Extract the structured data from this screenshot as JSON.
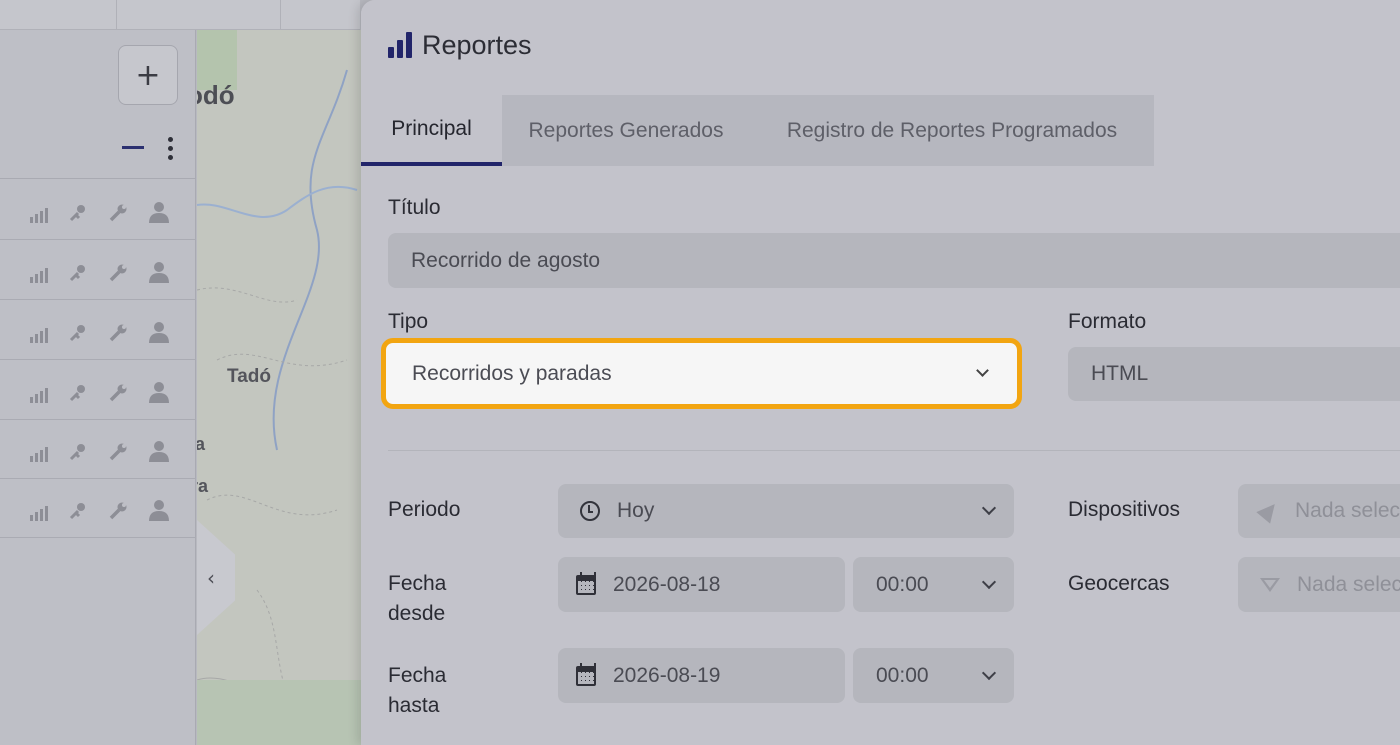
{
  "map": {
    "labels": [
      "odó",
      "Tadó",
      "a",
      "ra"
    ]
  },
  "modal": {
    "title": "Reportes",
    "tabs": [
      {
        "label": "Principal",
        "active": true
      },
      {
        "label": "Reportes Generados",
        "active": false
      },
      {
        "label": "Registro de Reportes Programados",
        "active": false
      }
    ]
  },
  "form": {
    "title_label": "Título",
    "title_value": "Recorrido de agosto",
    "type_label": "Tipo",
    "type_value": "Recorridos y paradas",
    "format_label": "Formato",
    "format_value": "HTML",
    "period_label": "Periodo",
    "period_value": "Hoy",
    "date_from_label": "Fecha desde",
    "date_from_value": "2026-08-18",
    "time_from_value": "00:00",
    "date_to_label": "Fecha hasta",
    "date_to_value": "2026-08-19",
    "time_to_value": "00:00",
    "devices_label": "Dispositivos",
    "devices_placeholder": "Nada selec",
    "geofences_label": "Geocercas",
    "geofences_placeholder": "Nada selec"
  },
  "colors": {
    "accent": "#22256a",
    "focus_border": "#f2a511"
  }
}
